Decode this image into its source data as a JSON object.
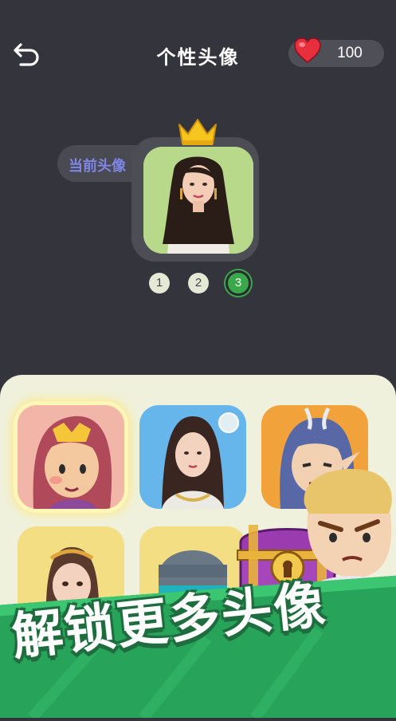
{
  "header": {
    "title": "个性头像",
    "hearts": "100",
    "back_icon": "back-arrow-icon",
    "heart_icon": "heart-icon"
  },
  "current": {
    "label": "当前头像",
    "crown_icon": "crown-icon"
  },
  "pages": [
    "1",
    "2",
    "3"
  ],
  "active_page": "3",
  "banner": {
    "text": "解锁更多头像"
  },
  "colors": {
    "background": "#34343c",
    "panel": "#eff1dc",
    "accent_green": "#3aa84a",
    "label_purple": "#7f86e6",
    "crown_yellow": "#f7c61e"
  }
}
